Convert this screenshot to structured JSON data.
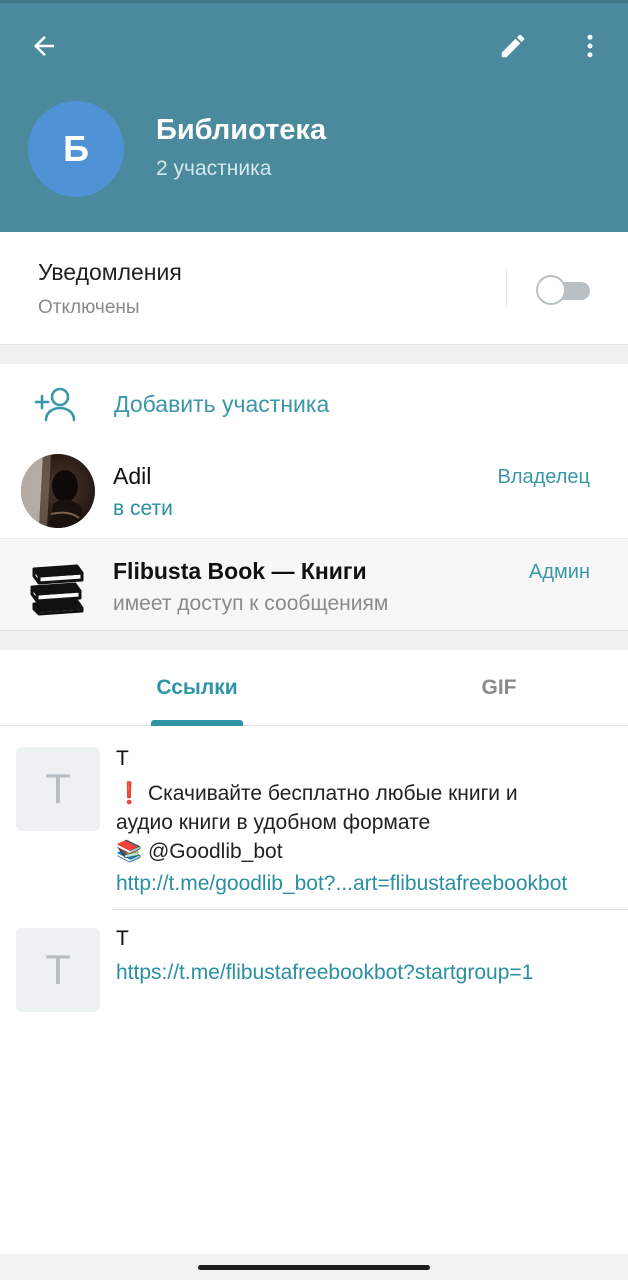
{
  "header": {
    "avatar_letter": "Б",
    "title": "Библиотека",
    "subtitle": "2 участника",
    "colors": {
      "background": "#4a8a9c",
      "avatar": "#4f92d6"
    },
    "icons": [
      "back-arrow-icon",
      "pencil-icon",
      "more-vertical-icon"
    ]
  },
  "notifications": {
    "title": "Уведомления",
    "status": "Отключены",
    "toggle_on": false
  },
  "members": {
    "add_label": "Добавить участника",
    "items": [
      {
        "name": "Adil",
        "status": "в сети",
        "role": "Владелец"
      },
      {
        "name": "Flibusta Book — Книги",
        "status": "имеет доступ к сообщениям",
        "role": "Админ"
      }
    ]
  },
  "tabs": {
    "items": [
      {
        "label": "Ссылки",
        "active": true
      },
      {
        "label": "GIF",
        "active": false
      }
    ],
    "accent": "#2f95a6"
  },
  "links": [
    {
      "thumb_letter": "T",
      "title": "T",
      "desc_line1": "❗ Скачивайте бесплатно любые книги и",
      "desc_line2": "аудио книги в удобном формате",
      "desc_line3": "📚 @Goodlib_bot",
      "url": "http://t.me/goodlib_bot?...art=flibustafreebookbot"
    },
    {
      "thumb_letter": "T",
      "title": "T",
      "url": "https://t.me/flibustafreebookbot?startgroup=1"
    }
  ]
}
